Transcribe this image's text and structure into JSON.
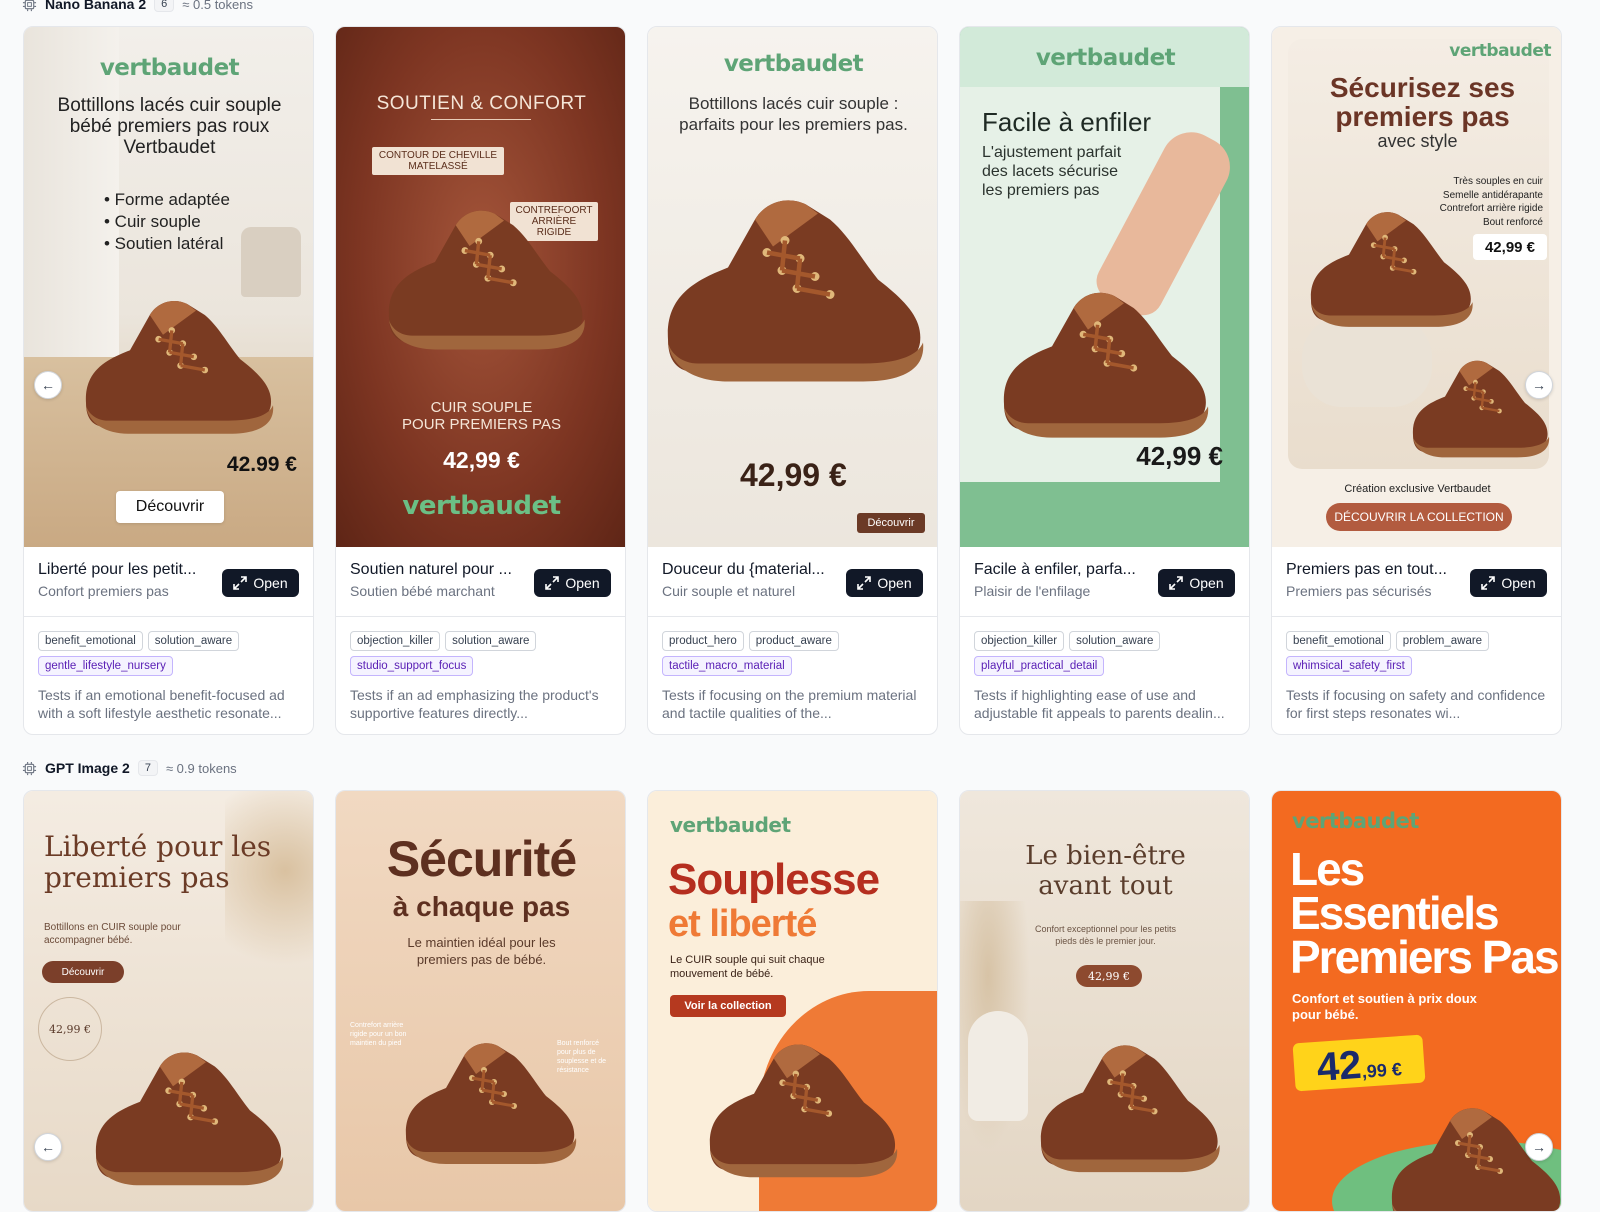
{
  "section1": {
    "model": "Nano Banana 2",
    "count": "6",
    "tokens": "≈ 0.5 tokens"
  },
  "section2": {
    "model": "GPT Image 2",
    "count": "7",
    "tokens": "≈ 0.9 tokens"
  },
  "open_label": "Open",
  "cards": [
    {
      "title": "Liberté pour les petit...",
      "subtitle": "Confort premiers pas",
      "tags": [
        "benefit_emotional",
        "solution_aware",
        "gentle_lifestyle_nursery"
      ],
      "description": "Tests if an emotional benefit-focused ad with a soft lifestyle aesthetic resonate...",
      "ad": {
        "brand": "vertbaudet",
        "headline": "Bottillons lacés cuir souple bébé premiers pas roux Vertbaudet",
        "bullets": [
          "• Forme adaptée",
          "• Cuir souple",
          "• Soutien latéral"
        ],
        "price": "42.99 €",
        "cta": "Découvrir"
      }
    },
    {
      "title": "Soutien naturel pour ...",
      "subtitle": "Soutien bébé marchant",
      "tags": [
        "objection_killer",
        "solution_aware",
        "studio_support_focus"
      ],
      "description": "Tests if an ad emphasizing the product's supportive features directly...",
      "ad": {
        "headline": "SOUTIEN & CONFORT",
        "callout1": "CONTOUR DE CHEVILLE MATELASSÉ",
        "callout2": "CONTREFOORT ARRIÈRE RIGIDE",
        "line1": "CUIR SOUPLE",
        "line2": "POUR PREMIERS PAS",
        "price": "42,99 €",
        "brand": "vertbaudet"
      }
    },
    {
      "title": "Douceur du {material...",
      "subtitle": "Cuir souple et naturel",
      "tags": [
        "product_hero",
        "product_aware",
        "tactile_macro_material"
      ],
      "description": "Tests if focusing on the premium material and tactile qualities of the...",
      "ad": {
        "brand": "vertbaudet",
        "headline": "Bottillons lacés cuir souple : parfaits pour les premiers pas.",
        "price": "42,99 €",
        "cta": "Découvrir"
      }
    },
    {
      "title": "Facile à enfiler, parfa...",
      "subtitle": "Plaisir de l'enfilage",
      "tags": [
        "objection_killer",
        "solution_aware",
        "playful_practical_detail"
      ],
      "description": "Tests if highlighting ease of use and adjustable fit appeals to parents dealin...",
      "ad": {
        "brand": "vertbaudet",
        "headline": "Facile à enfiler",
        "body": "L'ajustement parfait des lacets sécurise les premiers pas",
        "price": "42,99 €"
      }
    },
    {
      "title": "Premiers pas en tout...",
      "subtitle": "Premiers pas sécurisés",
      "tags": [
        "benefit_emotional",
        "problem_aware",
        "whimsical_safety_first"
      ],
      "description": "Tests if focusing on safety and confidence for first steps resonates wi...",
      "ad": {
        "brand": "vertbaudet",
        "headline": "Sécurisez ses premiers pas",
        "sub": "avec style",
        "features": [
          "Très souples en cuir",
          "Semelle antidérapante",
          "Contrefort arrière rigide",
          "Bout renforcé"
        ],
        "price": "42,99 €",
        "footer": "Création exclusive Vertbaudet",
        "cta": "DÉCOUVRIR LA COLLECTION"
      }
    }
  ],
  "gpt_cards": [
    {
      "headline": "Liberté pour les premiers pas",
      "body": "Bottillons en CUIR souple pour accompagner bébé.",
      "cta": "Découvrir",
      "price": "42,99 €"
    },
    {
      "headline1": "Sécurité",
      "headline2": "à chaque pas",
      "body": "Le maintien idéal pour les premiers pas de bébé.",
      "callout1": "Contrefort arrière rigide pour un bon maintien du pied",
      "callout2": "Bout renforcé pour plus de souplesse et de résistance"
    },
    {
      "brand": "vertbaudet",
      "headline1": "Souplesse",
      "headline2": "et liberté",
      "body": "Le CUIR souple qui suit chaque mouvement de bébé.",
      "cta": "Voir la collection"
    },
    {
      "headline": "Le bien-être avant tout",
      "body": "Confort exceptionnel pour les petits pieds dès le premier jour.",
      "price": "42,99 €"
    },
    {
      "brand": "vertbaudet",
      "headline": "Les Essentiels Premiers Pas",
      "body": "Confort et soutien à prix doux pour bébé.",
      "price_main": "42",
      "price_cents": ",99 €"
    }
  ]
}
